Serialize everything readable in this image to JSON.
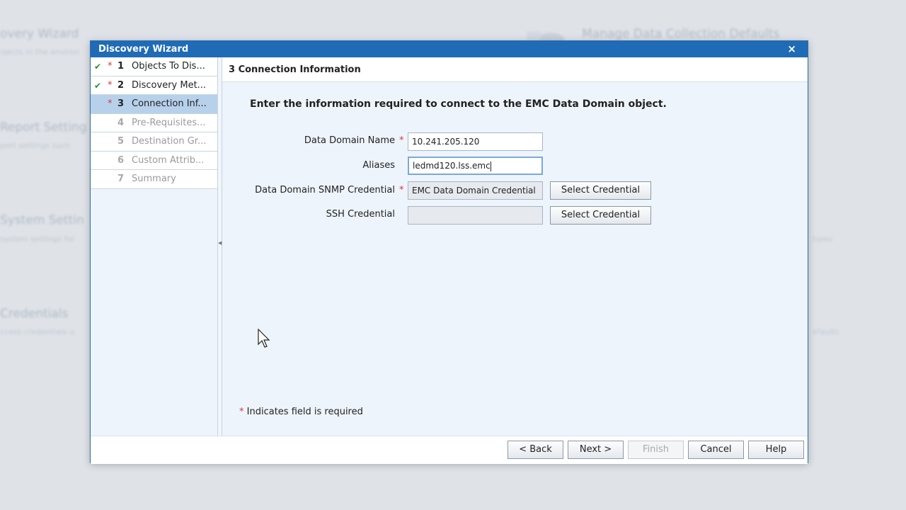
{
  "background": {
    "items": [
      {
        "title": "overy Wizard",
        "subtitle": "ojects in the environ"
      },
      {
        "title": "Manage Data Collection Defaults",
        "subtitle": ""
      },
      {
        "title": "Report Setting",
        "subtitle": "port settings such"
      },
      {
        "title": "System Settin",
        "subtitle": "system settings for"
      },
      {
        "title": "Credentials",
        "subtitle": "ccess credentials u"
      },
      {
        "title": "",
        "subtitle": "tures"
      },
      {
        "title": "",
        "subtitle": "efaults"
      }
    ]
  },
  "dialog": {
    "title": "Discovery Wizard",
    "close_glyph": "×",
    "steps": [
      {
        "num": "1",
        "label": "Objects To Dis...",
        "done": true,
        "required": true,
        "state": "done"
      },
      {
        "num": "2",
        "label": "Discovery Met...",
        "done": true,
        "required": true,
        "state": "done"
      },
      {
        "num": "3",
        "label": "Connection Inf...",
        "done": false,
        "required": true,
        "state": "current"
      },
      {
        "num": "4",
        "label": "Pre-Requisites...",
        "done": false,
        "required": false,
        "state": "future"
      },
      {
        "num": "5",
        "label": "Destination Gr...",
        "done": false,
        "required": false,
        "state": "future"
      },
      {
        "num": "6",
        "label": "Custom Attrib...",
        "done": false,
        "required": false,
        "state": "future"
      },
      {
        "num": "7",
        "label": "Summary",
        "done": false,
        "required": false,
        "state": "future"
      }
    ],
    "check_glyph": "✔",
    "required_glyph": "*",
    "content": {
      "header": "3  Connection Information",
      "intro": "Enter the information required to connect to the EMC Data Domain object.",
      "fields": {
        "name": {
          "label": "Data Domain Name",
          "value": "10.241.205.120",
          "required": true
        },
        "aliases": {
          "label": "Aliases",
          "value": "ledmd120.lss.emc",
          "required": false
        },
        "snmp": {
          "label": "Data Domain SNMP Credential",
          "value": "EMC Data Domain Credential",
          "required": true,
          "button": "Select Credential"
        },
        "ssh": {
          "label": "SSH Credential",
          "value": "",
          "required": false,
          "button": "Select Credential"
        }
      },
      "required_note": "Indicates field is required"
    },
    "footer": {
      "back": "< Back",
      "next": "Next >",
      "finish": "Finish",
      "cancel": "Cancel",
      "help": "Help"
    }
  }
}
